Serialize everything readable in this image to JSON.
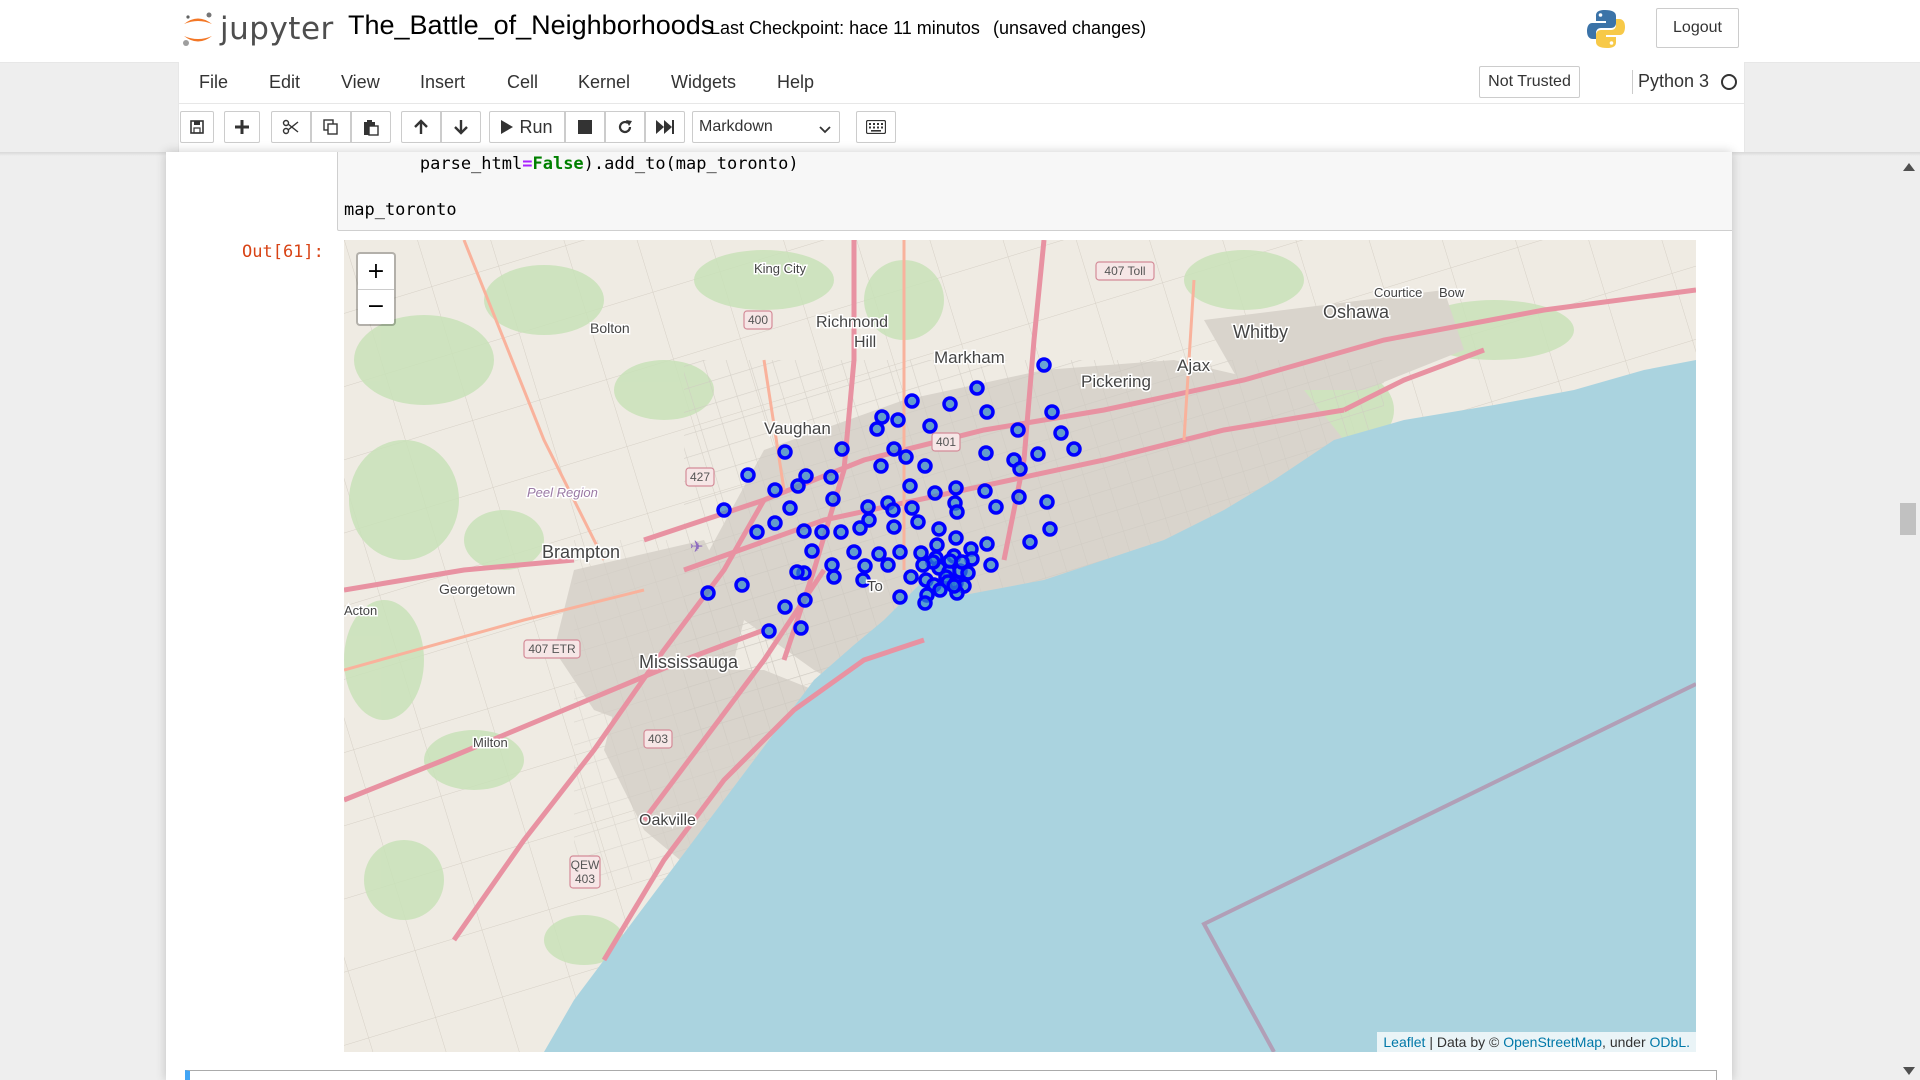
{
  "header": {
    "logo_text": "jupyter",
    "notebook_name": "The_Battle_of_Neighborhoods",
    "checkpoint": "Last Checkpoint: hace 11 minutos",
    "autosave_status": "(unsaved changes)",
    "logout_label": "Logout"
  },
  "menubar": {
    "items": [
      "File",
      "Edit",
      "View",
      "Insert",
      "Cell",
      "Kernel",
      "Widgets",
      "Help"
    ],
    "trust_label": "Not Trusted",
    "kernel_name": "Python 3"
  },
  "toolbar": {
    "run_label": "Run",
    "cell_type": "Markdown",
    "buttons": [
      "save-icon",
      "plus-icon",
      "scissors-icon",
      "copy-icon",
      "paste-icon",
      "arrow-up-icon",
      "arrow-down-icon",
      "play-icon",
      "stop-icon",
      "restart-icon",
      "fast-forward-icon",
      "keyboard-icon"
    ]
  },
  "cell": {
    "code_line_1a": "        parse_html",
    "code_line_1b": "=",
    "code_line_1c": "False",
    "code_line_1d": ").add_to(map_toronto)",
    "code_line_2": "map_toronto",
    "output_prompt": "Out[61]:"
  },
  "map": {
    "zoom_in": "+",
    "zoom_out": "−",
    "attribution": {
      "leaflet": "Leaflet",
      "sep1": " | Data by © ",
      "osm": "OpenStreetMap",
      "sep2": ", under ",
      "odbl": "ODbL."
    },
    "place_labels": [
      "King City",
      "Richmond Hill",
      "Markham",
      "Bolton",
      "Vaughan",
      "Oshawa",
      "Whitby",
      "Courtice",
      "Bow",
      "Ajax",
      "Pickering",
      "Brampton",
      "Georgetown",
      "Acton",
      "Peel Region",
      "Mississauga",
      "Milton",
      "Oakville",
      "To"
    ],
    "shields": [
      "400",
      "407 Toll",
      "401",
      "427",
      "407 ETR",
      "403",
      "QEW 403"
    ],
    "marker_color": "#0000ff",
    "marker_count": 103
  }
}
